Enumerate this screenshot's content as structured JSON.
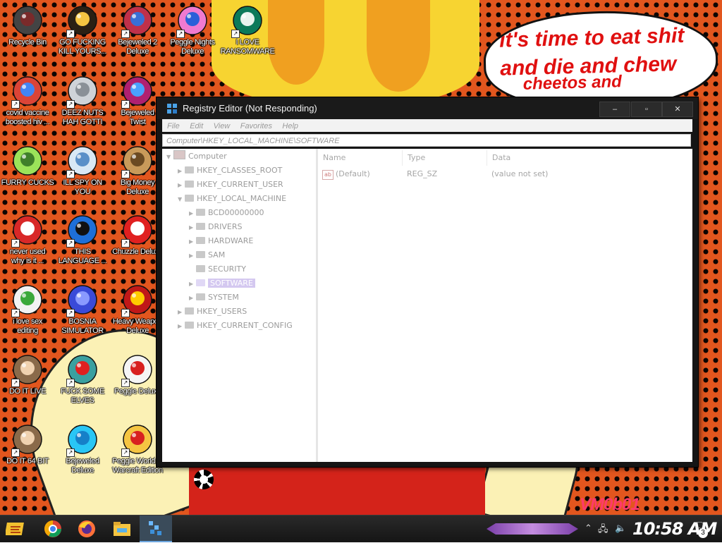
{
  "colors": {
    "wallpaper_orange": "#e2561e",
    "wallpaper_dots": "#0d0503",
    "bubble_text_red": "#e01010",
    "taskbar_dark": "#1c1c1c",
    "selection_lavender": "#d4c8f0",
    "watermark_pink": "#ff3a6a"
  },
  "wallpaper": {
    "bubble_lines": [
      "it's time to eat shit",
      "and die and chew",
      "cheetos and"
    ],
    "watermark": "VM0b01"
  },
  "desktop_icons": [
    {
      "caption": [
        "Recycle Bin"
      ],
      "icon": "recycle-bin-icon",
      "shortcut": false
    },
    {
      "caption": [
        "GO FUCKING",
        "KILL YOURS..."
      ],
      "icon": "adobe-de-icon",
      "shortcut": true
    },
    {
      "caption": [
        "Bejeweled 2",
        "Deluxe"
      ],
      "icon": "bejeweled-2-icon",
      "shortcut": true
    },
    {
      "caption": [
        "Peggle Nights",
        "Deluxe"
      ],
      "icon": "peggle-nights-icon",
      "shortcut": true
    },
    {
      "caption": [
        "I LOVE",
        "RANSOMWARE"
      ],
      "icon": "publisher-icon",
      "shortcut": true
    },
    {
      "caption": [
        "covid vaccine",
        "boosted hiv ..."
      ],
      "icon": "chrome-icon",
      "shortcut": true
    },
    {
      "caption": [
        "DEEZ NUTS",
        "HAH GOTTI"
      ],
      "icon": "windows-stack-icon",
      "shortcut": true
    },
    {
      "caption": [
        "Bejeweled",
        "Twist"
      ],
      "icon": "bejeweled-twist-icon",
      "shortcut": true
    },
    {
      "caption": [
        "FURRY CUCKS"
      ],
      "icon": "peridot-character-icon",
      "shortcut": false
    },
    {
      "caption": [
        "ILL SPY ON",
        "YOU"
      ],
      "icon": "network-spy-icon",
      "shortcut": true
    },
    {
      "caption": [
        "Big Money",
        "Deluxe"
      ],
      "icon": "money-bag-icon",
      "shortcut": true
    },
    {
      "caption": [
        "never used",
        "why is it ..."
      ],
      "icon": "dev-cpp-icon",
      "shortcut": true
    },
    {
      "caption": [
        "THIS",
        "LANGUAGE ..."
      ],
      "icon": "goland-icon",
      "shortcut": true
    },
    {
      "caption": [
        "Chuzzle Deluxe"
      ],
      "icon": "chuzzle-icon",
      "shortcut": true
    },
    {
      "caption": [
        "i love sex",
        "editing"
      ],
      "icon": "hxd-icon",
      "shortcut": true
    },
    {
      "caption": [
        "BOSNIA",
        "SIMULATOR"
      ],
      "icon": "spiked-mine-icon",
      "shortcut": true
    },
    {
      "caption": [
        "Heavy Weapon",
        "Deluxe"
      ],
      "icon": "radiation-icon",
      "shortcut": true
    },
    {
      "caption": [
        "DO IT LIVE"
      ],
      "icon": "portrait-icon",
      "shortcut": true
    },
    {
      "caption": [
        "FUCK SOME",
        "ELVES"
      ],
      "icon": "santa-icon",
      "shortcut": true
    },
    {
      "caption": [
        "Peggle Deluxe"
      ],
      "icon": "peggle-icon",
      "shortcut": true
    },
    {
      "caption": [
        "DO IT 64 BIT"
      ],
      "icon": "portrait-64-icon",
      "shortcut": true
    },
    {
      "caption": [
        "Bejeweled",
        "Deluxe"
      ],
      "icon": "bejeweled-gem-icon",
      "shortcut": true
    },
    {
      "caption": [
        "Peggle World of",
        "Warcraft Edition"
      ],
      "icon": "peggle-wow-icon",
      "shortcut": true
    }
  ],
  "regedit": {
    "title": "Registry Editor (Not Responding)",
    "buttons": {
      "minimize": "–",
      "maximize": "▫",
      "close": "✕"
    },
    "menu": [
      "File",
      "Edit",
      "View",
      "Favorites",
      "Help"
    ],
    "address": "Computer\\HKEY_LOCAL_MACHINE\\SOFTWARE",
    "tree": {
      "root": "Computer",
      "hives": {
        "classes_root": "HKEY_CLASSES_ROOT",
        "current_user": "HKEY_CURRENT_USER",
        "local_machine": "HKEY_LOCAL_MACHINE",
        "users": "HKEY_USERS",
        "current_config": "HKEY_CURRENT_CONFIG"
      },
      "local_machine_children": [
        "BCD00000000",
        "DRIVERS",
        "HARDWARE",
        "SAM",
        "SECURITY",
        "SOFTWARE",
        "SYSTEM"
      ],
      "selected": "SOFTWARE"
    },
    "columns": [
      "Name",
      "Type",
      "Data"
    ],
    "values": [
      {
        "name": "(Default)",
        "type": "REG_SZ",
        "data": "(value not set)"
      }
    ]
  },
  "taskbar": {
    "pinned": [
      "start-orb-icon",
      "chrome-icon",
      "firefox-icon",
      "explorer-icon",
      "regedit-icon"
    ],
    "clock": "10:58 AM",
    "notification_count": "3",
    "tray_icons": [
      "show-hidden-arrow-icon",
      "network-icon",
      "volume-muted-icon",
      "notifications-icon"
    ]
  }
}
